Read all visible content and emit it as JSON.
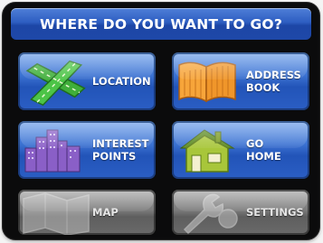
{
  "header": {
    "title": "WHERE DO YOU WANT TO GO?"
  },
  "menu": {
    "location": {
      "label": "LOCATION",
      "icon": "crossroads-icon"
    },
    "address_book": {
      "line1": "ADDRESS",
      "line2": "BOOK",
      "icon": "open-book-icon"
    },
    "interest_points": {
      "line1": "INTEREST",
      "line2": "POINTS",
      "icon": "city-buildings-icon"
    },
    "go_home": {
      "line1": "GO",
      "line2": "HOME",
      "icon": "house-icon"
    },
    "map": {
      "label": "MAP",
      "icon": "map-icon",
      "state": "disabled"
    },
    "settings": {
      "label": "SETTINGS",
      "icon": "wrench-icon",
      "state": "disabled"
    }
  },
  "colors": {
    "accent_blue": "#2d5dc1",
    "disabled_gray": "#7c7c7c",
    "location_icon_green": "#3fae3a",
    "book_icon_orange": "#f0962a",
    "interest_icon_purple": "#8a5fc7",
    "home_icon_green": "#a8c63a"
  }
}
